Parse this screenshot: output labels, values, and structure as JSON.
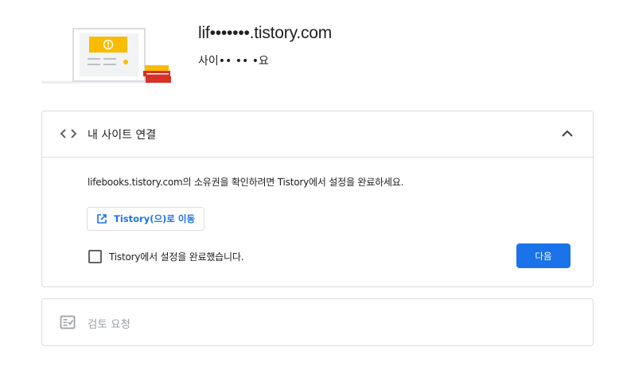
{
  "header": {
    "site_title": "lif•••••••.tistory.com",
    "site_subtitle": "사이•• •• •요"
  },
  "connect_card": {
    "title": "내 사이트 연결",
    "description": "lifebooks.tistory.com의 소유권을 확인하려면 Tistory에서 설정을 완료하세요.",
    "go_button_label": "Tistory(으)로 이동",
    "checkbox_label": "Tistory에서 설정을 완료했습니다.",
    "checkbox_checked": false,
    "next_button_label": "다음",
    "expanded": true
  },
  "review_card": {
    "title": "검토 요청",
    "enabled": false
  },
  "colors": {
    "accent": "#1a73e8",
    "border": "#dadce0",
    "text": "#202124",
    "disabled_text": "#9aa0a6",
    "illus_yellow": "#f9bc00",
    "illus_red": "#d93025"
  },
  "icons": {
    "code": "code-icon",
    "chevron": "chevron-up-icon",
    "external": "open-in-new-icon",
    "review": "fact-check-icon"
  }
}
